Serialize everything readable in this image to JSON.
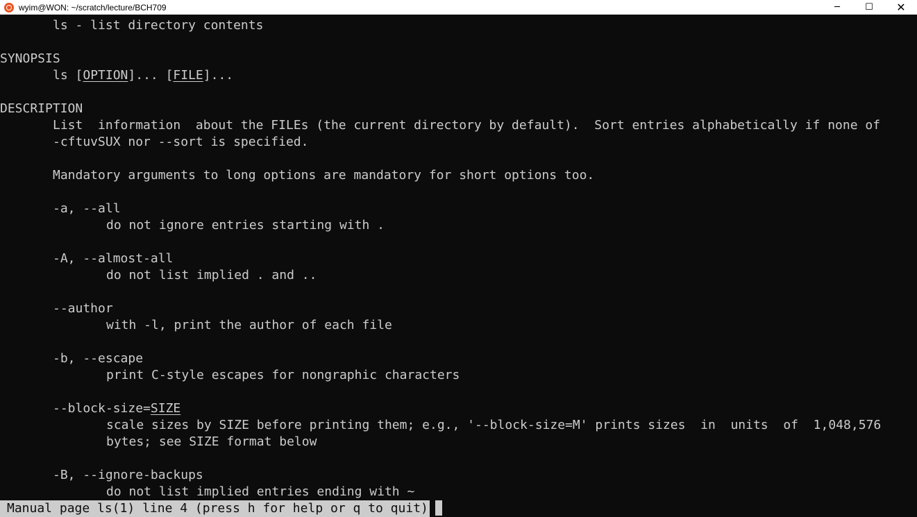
{
  "window": {
    "title": "wyim@WON: ~/scratch/lecture/BCH709",
    "minimize_glyph": "─",
    "maximize_glyph": "☐",
    "close_glyph": "✕",
    "app_icon": "ubuntu-icon"
  },
  "man": {
    "name_line": "ls - list directory contents",
    "synopsis_heading": "SYNOPSIS",
    "synopsis_ls": "ls ",
    "synopsis_open1": "[",
    "synopsis_option": "OPTION",
    "synopsis_close1": "]... [",
    "synopsis_file": "FILE",
    "synopsis_close2": "]...",
    "description_heading": "DESCRIPTION",
    "desc_line1": "List  information  about the FILEs (the current directory by default).  Sort entries alphabetically if none of",
    "desc_line2": "-cftuvSUX nor --sort is specified.",
    "desc_line3": "Mandatory arguments to long options are mandatory for short options too.",
    "options": [
      {
        "flag": "-a, --all",
        "desc": [
          "do not ignore entries starting with ."
        ]
      },
      {
        "flag": "-A, --almost-all",
        "desc": [
          "do not list implied . and .."
        ]
      },
      {
        "flag": "--author",
        "desc": [
          "with -l, print the author of each file"
        ]
      },
      {
        "flag": "-b, --escape",
        "desc": [
          "print C-style escapes for nongraphic characters"
        ]
      },
      {
        "flag_prefix": "--block-size=",
        "flag_arg": "SIZE",
        "desc": [
          "scale sizes by SIZE before printing them; e.g., '--block-size=M' prints sizes  in  units  of  1,048,576",
          "bytes; see SIZE format below"
        ]
      },
      {
        "flag": "-B, --ignore-backups",
        "desc": [
          "do not list implied entries ending with ~"
        ]
      }
    ]
  },
  "status": {
    "text": "Manual page ls(1) line 4 (press h for help or q to quit)"
  }
}
